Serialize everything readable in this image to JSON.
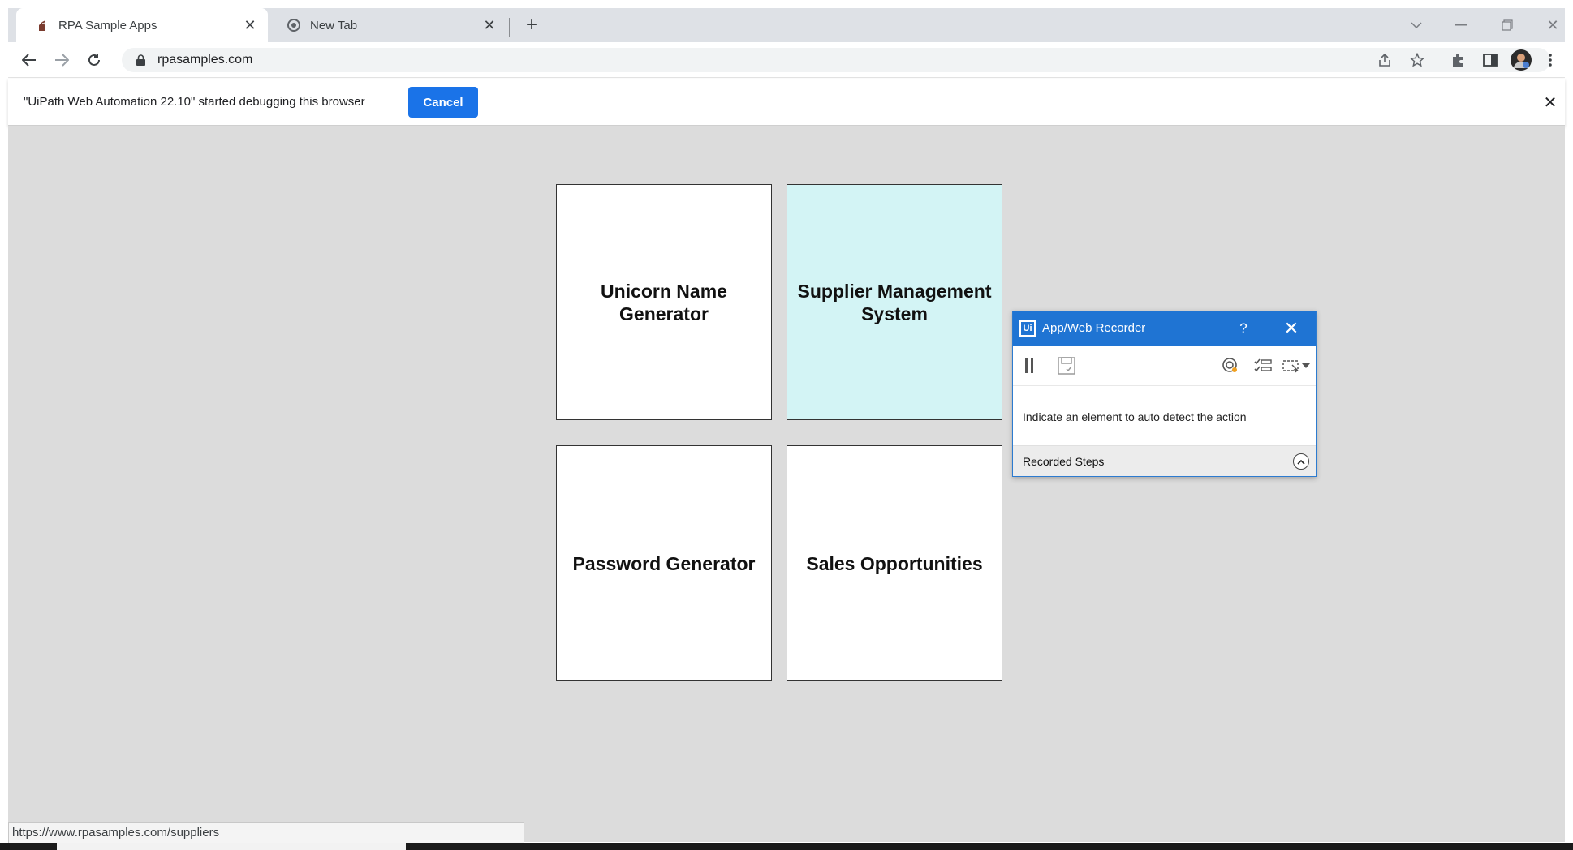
{
  "browser": {
    "tabs": [
      {
        "title": "RPA Sample Apps",
        "icon": "unicorn-favicon-icon",
        "active": true
      },
      {
        "title": "New Tab",
        "icon": "chrome-icon",
        "active": false
      }
    ],
    "url": "rpasamples.com",
    "status_url": "https://www.rpasamples.com/suppliers"
  },
  "infobar": {
    "message": "\"UiPath Web Automation 22.10\" started debugging this browser",
    "cancel_label": "Cancel"
  },
  "cards": [
    {
      "label": "Unicorn Name Generator"
    },
    {
      "label": "Supplier Management System"
    },
    {
      "label": "Password Generator"
    },
    {
      "label": "Sales Opportunities"
    }
  ],
  "recorder": {
    "logo": "Ui",
    "title": "App/Web Recorder",
    "help": "?",
    "hint": "Indicate an element to auto detect the action",
    "steps_label": "Recorded Steps"
  },
  "colors": {
    "accent_blue": "#1a73e8",
    "recorder_blue": "#1f74d3",
    "card_hover": "#d3f4f5",
    "page_bg": "#dcdcdc"
  }
}
